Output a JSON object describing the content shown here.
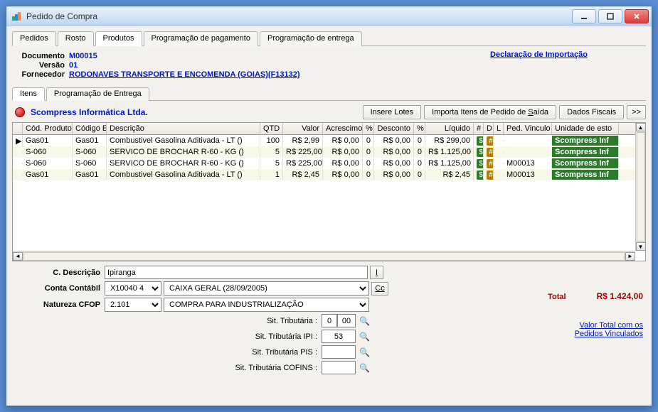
{
  "window": {
    "title": "Pedido de Compra"
  },
  "main_tabs": [
    "Pedidos",
    "Rosto",
    "Produtos",
    "Programação de pagamento",
    "Programação de entrega"
  ],
  "active_main_tab": 2,
  "header": {
    "doc_label": "Documento",
    "doc_value": "M00015",
    "ver_label": "Versão",
    "ver_value": "01",
    "forn_label": "Fornecedor",
    "forn_value": "RODONAVES TRANSPORTE E ENCOMENDA (GOIAS)(F13132)",
    "decl_link": "Declaração de Importação"
  },
  "sub_tabs": [
    "Itens",
    "Programação de Entrega"
  ],
  "active_sub_tab": 0,
  "company": "Scompress Informática Ltda.",
  "toolbar": {
    "insere_lotes": "Insere Lotes",
    "importa_itens": "Importa Itens de Pedido de Saída",
    "dados_fiscais": "Dados Fiscais",
    "more": ">>"
  },
  "grid": {
    "headers": {
      "cod": "Cód. Produto",
      "code": "Código E",
      "desc": "Descrição",
      "qtd": "QTD",
      "valor": "Valor",
      "acres": "Acrescimo",
      "pct1": "%",
      "desc2": "Desconto",
      "pct2": "%",
      "liq": "Líquido",
      "hash": "#",
      "d": "D",
      "l": "L",
      "ped": "Ped. Vinculo",
      "unid": "Unidade de esto"
    },
    "rows": [
      {
        "cod": "Gas01",
        "code": "Gas01",
        "desc": "Combustivel Gasolina Aditivada  - LT ()",
        "qtd": "100",
        "valor": "R$ 2,99",
        "acres": "R$ 0,00",
        "pct1": "0",
        "desc2": "R$ 0,00",
        "pct2": "0",
        "liq": "R$ 299,00",
        "ped": "",
        "unid": "Scompress Inf"
      },
      {
        "cod": "S-060",
        "code": "S-060",
        "desc": "SERVICO DE BROCHAR R-60 - KG ()",
        "qtd": "5",
        "valor": "R$ 225,00",
        "acres": "R$ 0,00",
        "pct1": "0",
        "desc2": "R$ 0,00",
        "pct2": "0",
        "liq": "R$ 1.125,00",
        "ped": "",
        "unid": "Scompress Inf"
      },
      {
        "cod": "S-060",
        "code": "S-060",
        "desc": "SERVICO DE BROCHAR R-60 - KG ()",
        "qtd": "5",
        "valor": "R$ 225,00",
        "acres": "R$ 0,00",
        "pct1": "0",
        "desc2": "R$ 0,00",
        "pct2": "0",
        "liq": "R$ 1.125,00",
        "ped": "M00013",
        "unid": "Scompress Inf"
      },
      {
        "cod": "Gas01",
        "code": "Gas01",
        "desc": "Combustivel Gasolina Aditivada  - LT ()",
        "qtd": "1",
        "valor": "R$ 2,45",
        "acres": "R$ 0,00",
        "pct1": "0",
        "desc2": "R$ 0,00",
        "pct2": "0",
        "liq": "R$ 2,45",
        "ped": "M00013",
        "unid": "Scompress Inf"
      }
    ]
  },
  "form": {
    "cdesc_label": "C. Descrição",
    "cdesc_value": "Ipiranga",
    "cdesc_btn": "I",
    "conta_label": "Conta Contábil",
    "conta_code": "X10040 4",
    "conta_desc": "CAIXA GERAL (28/09/2005)",
    "conta_btn": "Cc",
    "cfop_label": "Natureza CFOP",
    "cfop_code": "2.101",
    "cfop_desc": "COMPRA PARA INDUSTRIALIZAÇÃO",
    "sit_trib_label": "Sit. Tributária :",
    "sit_trib_a": "0",
    "sit_trib_b": "00",
    "sit_ipi_label": "Sit. Tributária IPI :",
    "sit_ipi_value": "53",
    "sit_pis_label": "Sit. Tributária PIS :",
    "sit_pis_value": "",
    "sit_cofins_label": "Sit. Tributária COFINS :",
    "sit_cofins_value": ""
  },
  "totals": {
    "total_label": "Total",
    "total_value": "R$ 1.424,00",
    "link1": "Valor Total com os",
    "link2": "Pedidos Vinculados"
  }
}
